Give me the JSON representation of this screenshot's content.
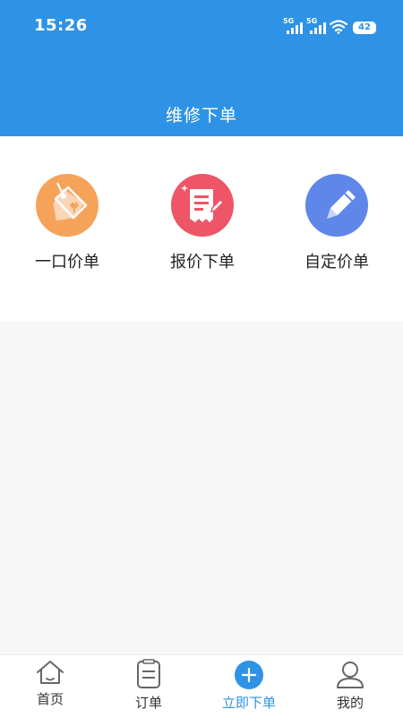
{
  "status_bar": {
    "time": "15:26",
    "signal_1": "5G",
    "signal_2": "5G",
    "battery": "42"
  },
  "header": {
    "title": "维修下单",
    "background": "#2e93e6"
  },
  "order_types": [
    {
      "label": "一口价单",
      "icon": "price-tag-icon",
      "color": "#f6a35a"
    },
    {
      "label": "报价下单",
      "icon": "quote-receipt-icon",
      "color": "#ee5566"
    },
    {
      "label": "自定价单",
      "icon": "pencil-icon",
      "color": "#5f87ea"
    }
  ],
  "tabbar": {
    "items": [
      {
        "label": "首页",
        "icon": "home-icon",
        "active": false
      },
      {
        "label": "订单",
        "icon": "order-list-icon",
        "active": false
      },
      {
        "label": "立即下单",
        "icon": "plus-circle-icon",
        "active": true
      },
      {
        "label": "我的",
        "icon": "user-icon",
        "active": false
      }
    ],
    "active_color": "#2e93e6"
  }
}
